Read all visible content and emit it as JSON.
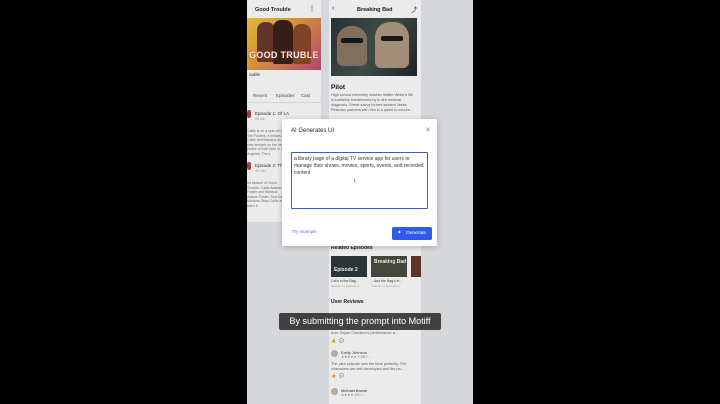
{
  "left_card": {
    "title": "Good Trouble",
    "poster_logo": "GOOD TRUBLE",
    "subtitle": "ouble",
    "tabs": [
      "Recent",
      "Episodes",
      "Cast"
    ],
    "episode1": {
      "name": "Episode 1: Of LA",
      "meta": "45 min"
    },
    "episode1_text": "Callie is on a spin-off of The Fosters, it follows Callie and Mariana as they embark on the next phase of their lives in Los Angeles. The s",
    "episode2": {
      "name": "Episode 2: The",
      "meta": "45 min"
    },
    "episode2_text": "rst season of Good Trouble. Callie Adams Foster and Mariana Adams Foster. Sun Callie Mariana Story Callie as she's b"
  },
  "right_card": {
    "title": "Breaking Bad",
    "episode_title": "Pilot",
    "description": "High school chemistry teacher Walter White's life is suddenly transformed by a dire medical diagnosis. Street-savvy former student Jesse Pinkman partners with him in a quest to secure...",
    "related_heading": "Related Episodes",
    "related": [
      {
        "thumb_label": "Episode 2",
        "name": "Cat's in the Bag...",
        "meta": "Season 1 | Episode 2"
      },
      {
        "thumb_label": "Breaking Bad",
        "name": "...And the Bag's in...",
        "meta": "Season 1 | Episode 3"
      }
    ],
    "reviews_heading": "User Reviews",
    "review0_text": "ever. Bryan Cranston's performance a...",
    "reviews": [
      {
        "name": "Emily Johnson",
        "stars": "★★★★★ 4.5/5 • ...",
        "text": "The pilot episode sets the tone perfectly. The characters are well-developed and the pa..."
      },
      {
        "name": "Michael Brown",
        "stars": "★★★★ 4/5 • ...",
        "text": ""
      }
    ]
  },
  "modal": {
    "title": "AI Generates UI",
    "prompt": "a library page of a digital TV service app for users to manage their shows, movies, sports, events, and recorded content",
    "try_example": "Try example",
    "generate": "Generate"
  },
  "caption": "By submitting the prompt into Motiff",
  "colors": {
    "accent": "#2f5bea",
    "link": "#5a72e8",
    "focus_border": "#3b55e6"
  }
}
